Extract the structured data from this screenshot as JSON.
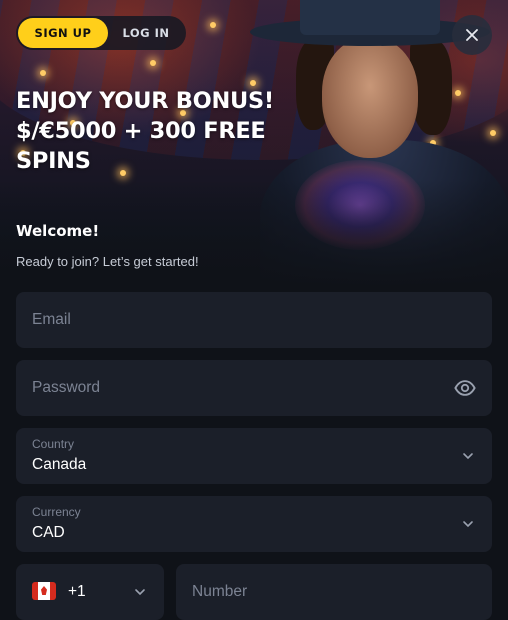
{
  "auth": {
    "signup_label": "SIGN UP",
    "login_label": "LOG IN",
    "active": "signup"
  },
  "close_icon": "close-icon",
  "promo": {
    "line1": "ENJOY YOUR BONUS!",
    "line2": "$/€5000 + 300 FREE",
    "line3": "SPINS"
  },
  "welcome": {
    "title": "Welcome!",
    "subtitle": "Ready to join? Let’s get started!"
  },
  "form": {
    "email_placeholder": "Email",
    "password_placeholder": "Password",
    "password_toggle_icon": "eye-icon",
    "country_label": "Country",
    "country_value": "Canada",
    "currency_label": "Currency",
    "currency_value": "CAD",
    "phone_code": "+1",
    "phone_flag": "canada-flag-icon",
    "number_placeholder": "Number"
  },
  "colors": {
    "accent": "#ffcf1a",
    "background": "#0f1218",
    "field_bg": "#1b1f29",
    "placeholder": "#7c8393"
  }
}
